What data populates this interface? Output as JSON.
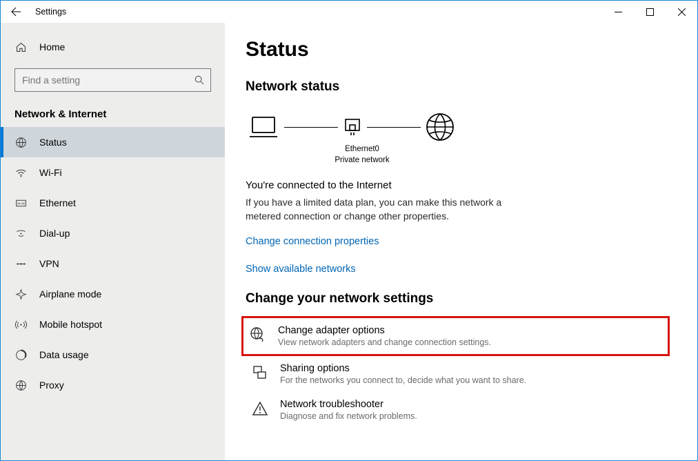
{
  "window": {
    "title": "Settings"
  },
  "sidebar": {
    "home": "Home",
    "search_placeholder": "Find a setting",
    "category": "Network & Internet",
    "items": [
      {
        "label": "Status"
      },
      {
        "label": "Wi-Fi"
      },
      {
        "label": "Ethernet"
      },
      {
        "label": "Dial-up"
      },
      {
        "label": "VPN"
      },
      {
        "label": "Airplane mode"
      },
      {
        "label": "Mobile hotspot"
      },
      {
        "label": "Data usage"
      },
      {
        "label": "Proxy"
      }
    ]
  },
  "main": {
    "title": "Status",
    "status_heading": "Network status",
    "diagram": {
      "adapter_name": "Ethernet0",
      "net_type": "Private network"
    },
    "connected_heading": "You're connected to the Internet",
    "connected_desc": "If you have a limited data plan, you can make this network a metered connection or change other properties.",
    "link_change_props": "Change connection properties",
    "link_show_avail": "Show available networks",
    "settings_heading": "Change your network settings",
    "rows": [
      {
        "title": "Change adapter options",
        "desc": "View network adapters and change connection settings."
      },
      {
        "title": "Sharing options",
        "desc": "For the networks you connect to, decide what you want to share."
      },
      {
        "title": "Network troubleshooter",
        "desc": "Diagnose and fix network problems."
      }
    ]
  }
}
